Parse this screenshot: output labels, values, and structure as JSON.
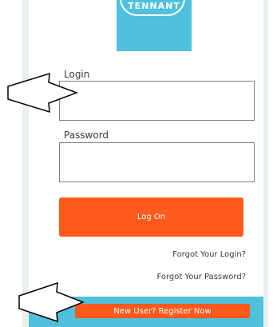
{
  "brand": {
    "logo_text": "TENNANT",
    "logo_color": "#4fc1dc"
  },
  "form": {
    "login_label": "Login",
    "login_value": "",
    "password_label": "Password",
    "password_value": "",
    "logon_label": "Log On"
  },
  "links": {
    "forgot_login": "Forgot Your Login?",
    "forgot_password": "Forgot Your Password?",
    "register": "New User? Register Now"
  },
  "colors": {
    "accent": "#ff5a1c",
    "brand_blue": "#4fc1dc",
    "side_stripe": "#e8f0ea"
  },
  "annotations": {
    "arrow_icon_1": "arrow-right-icon",
    "arrow_icon_2": "arrow-right-icon"
  }
}
